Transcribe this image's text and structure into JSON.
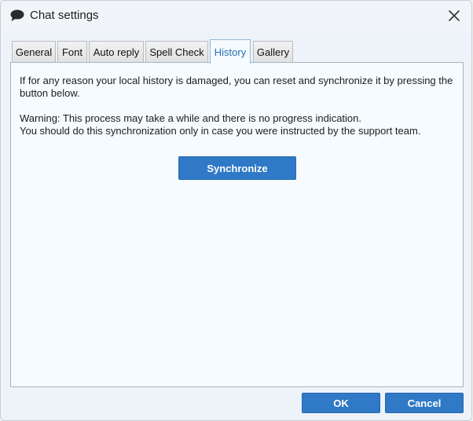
{
  "window": {
    "title": "Chat settings",
    "icon": "chat-bubble-icon",
    "close_icon": "close-icon"
  },
  "tabs": [
    {
      "label": "General",
      "active": false
    },
    {
      "label": "Font",
      "active": false
    },
    {
      "label": "Auto reply",
      "active": false
    },
    {
      "label": "Spell Check",
      "active": false
    },
    {
      "label": "History",
      "active": true
    },
    {
      "label": "Gallery",
      "active": false
    }
  ],
  "history": {
    "line1": "If for any reason your local history is damaged, you can reset and synchronize it by pressing the",
    "line2": "button below.",
    "line3": "Warning: This process may take a while and there is no progress indication.",
    "line4": "You should do this synchronization only in case you were instructed by the support team.",
    "sync_label": "Synchronize"
  },
  "footer": {
    "ok_label": "OK",
    "cancel_label": "Cancel"
  },
  "colors": {
    "accent": "#2f79c6",
    "active_tab_text": "#2a6fb4",
    "panel_bg": "#f5fbfe"
  }
}
